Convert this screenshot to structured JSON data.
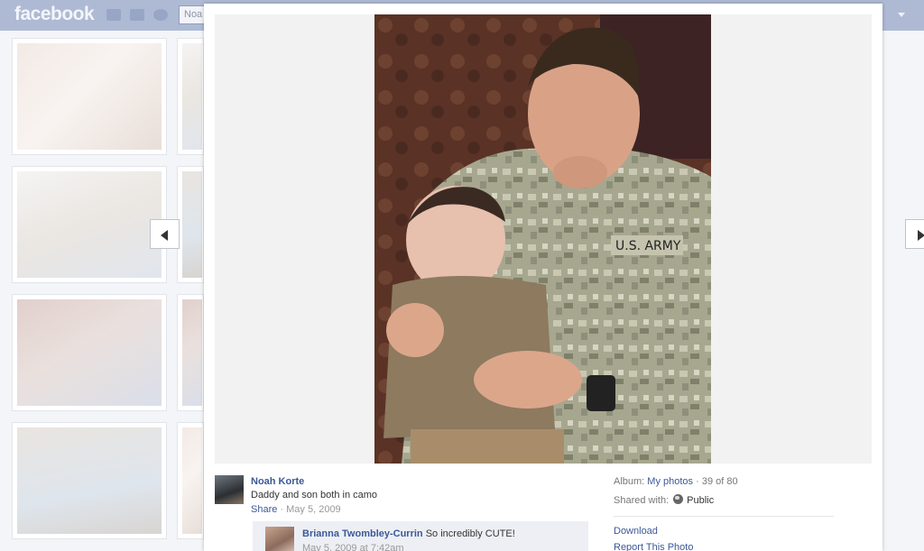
{
  "topbar": {
    "logo": "facebook",
    "search_value": "Noa"
  },
  "viewer": {
    "photo": {
      "description_icon": "photo-image"
    },
    "author": {
      "name": "Noah Korte",
      "caption": "Daddy and son both in camo",
      "share_label": "Share",
      "separator": " · ",
      "date": "May 5, 2009"
    },
    "comment": {
      "name": "Brianna Twombley-Currin",
      "text": " So incredibly CUTE!",
      "time": "May 5, 2009 at 7:42am"
    },
    "album": {
      "label": "Album: ",
      "name": "My photos",
      "position": " · 39 of 80"
    },
    "shared": {
      "label": "Shared with:",
      "value": "Public"
    },
    "links": {
      "download": "Download",
      "report": "Report This Photo"
    }
  },
  "colors": {
    "fb_blue": "#3b5998",
    "topbar_dimmed": "#aebad4"
  }
}
